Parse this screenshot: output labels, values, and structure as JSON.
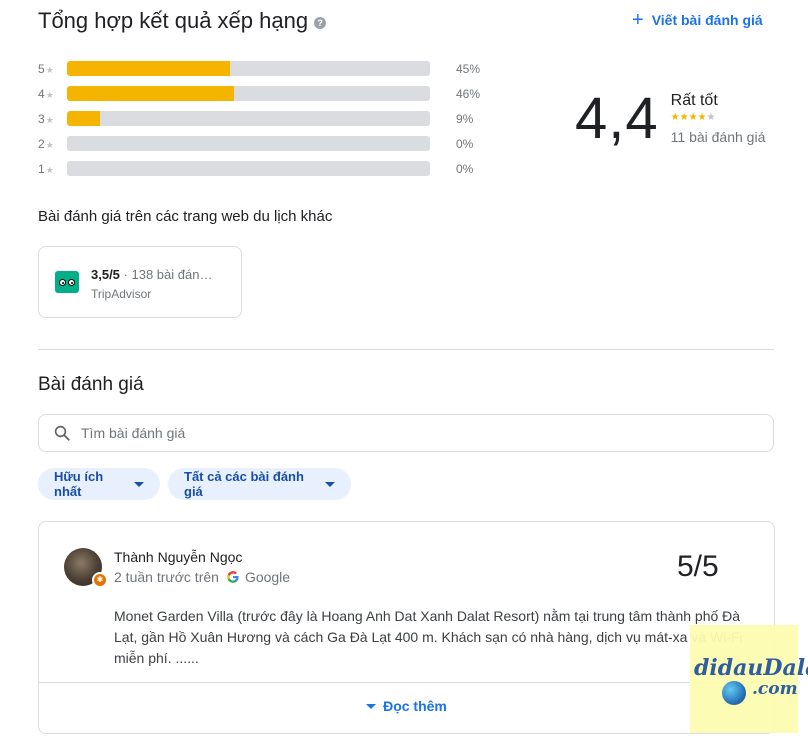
{
  "header": {
    "title": "Tổng hợp kết quả xếp hạng",
    "help_icon": "?",
    "write_review": "Viết bài đánh giá"
  },
  "rating_bars": [
    {
      "stars": "5",
      "percent": 45,
      "percent_label": "45%"
    },
    {
      "stars": "4",
      "percent": 46,
      "percent_label": "46%"
    },
    {
      "stars": "3",
      "percent": 9,
      "percent_label": "9%"
    },
    {
      "stars": "2",
      "percent": 0,
      "percent_label": "0%"
    },
    {
      "stars": "1",
      "percent": 0,
      "percent_label": "0%"
    }
  ],
  "summary": {
    "score": "4,4",
    "label": "Rất tốt",
    "count": "11 bài đánh giá",
    "star_rating": 4.4
  },
  "other_sites": {
    "heading": "Bài đánh giá trên các trang web du lịch khác",
    "tripadvisor": {
      "score": "3,5/5",
      "count": "· 138 bài đán…",
      "source": "TripAdvisor"
    }
  },
  "reviews": {
    "title": "Bài đánh giá",
    "search_placeholder": "Tìm bài đánh giá",
    "sort_chip": "Hữu ích nhất",
    "filter_chip": "Tất cả các bài đánh giá",
    "items": [
      {
        "name": "Thành Nguyễn Ngọc",
        "time": "2 tuần trước trên",
        "source": "Google",
        "score": "5/5",
        "text": "Monet Garden Villa (trước đây là Hoang Anh Dat Xanh Dalat Resort) nằm tại trung tâm thành phố Đà Lạt, gần Hồ Xuân Hương và cách Ga Đà Lạt 400 m. Khách sạn có nhà hàng, dịch vụ mát-xa và Wi-Fi miễn phí. ......",
        "read_more": "Đọc thêm"
      }
    ]
  },
  "watermark": {
    "line1": "didauDalat",
    "line2": ".com"
  },
  "colors": {
    "star_fill": "#f4b400",
    "link": "#1a73e8",
    "chip_bg": "#e8f0fe"
  }
}
